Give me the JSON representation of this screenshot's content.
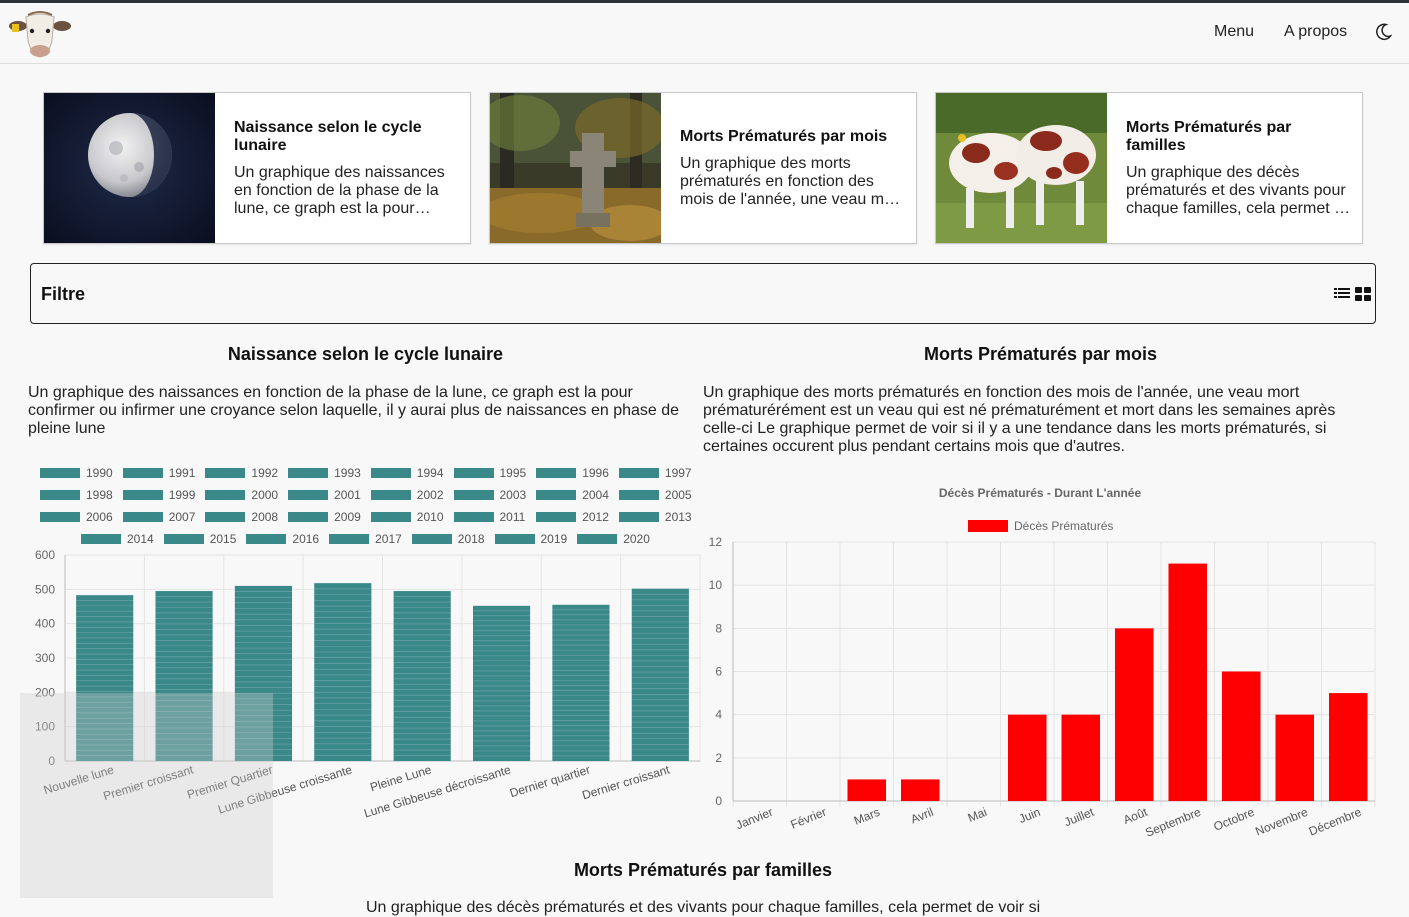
{
  "nav": {
    "menu_label": "Menu",
    "about_label": "A propos",
    "logo_icon": "cow-head-icon",
    "theme_icon": "moon-icon"
  },
  "cards": [
    {
      "title": "Naissance selon le cycle lunaire",
      "text": "Un graphique des naissances en fonction de la phase de la lune, ce graph est la pour confirmer ou infirmer une croyance selon laquelle, il y aurai plus de naissances en phase de pleine lune",
      "image_icon": "moon-photo"
    },
    {
      "title": "Morts Prématurés par mois",
      "text": "Un graphique des morts prématurés en fonction des mois de l'année, une veau mort prématurérément est un veau qui est né prématurément et mort dans les semaines après celle-ci",
      "image_icon": "cemetery-photo"
    },
    {
      "title": "Morts Prématurés par familles",
      "text": "Un graphique des décès prématurés et des vivants pour chaque familles, cela permet de voir si",
      "image_icon": "calves-photo"
    }
  ],
  "filter": {
    "title": "Filtre",
    "list_view_icon": "list-view-icon",
    "grid_view_icon": "grid-view-icon"
  },
  "sections": {
    "lunar": {
      "title": "Naissance selon le cycle lunaire",
      "description": "Un graphique des naissances en fonction de la phase de la lune, ce graph est la pour confirmer ou infirmer une croyance selon laquelle, il y aurai plus de naissances en phase de pleine lune"
    },
    "monthly": {
      "title": "Morts Prématurés par mois",
      "description": "Un graphique des morts prématurés en fonction des mois de l'année, une veau mort prématurérément est un veau qui est né prématurément et mort dans les semaines après celle-ci Le graphique permet de voir si il y a une tendance dans les morts prématurés, si certaines occurent plus pendant certains mois que d'autres."
    },
    "families": {
      "title": "Morts Prématurés par familles",
      "description": "Un graphique des décès prématurés et des vivants pour chaque familles, cela permet de voir si"
    }
  },
  "chart_data": [
    {
      "type": "bar",
      "title": "",
      "legend_position": "top",
      "legend": [
        "1990",
        "1991",
        "1992",
        "1993",
        "1994",
        "1995",
        "1996",
        "1997",
        "1998",
        "1999",
        "2000",
        "2001",
        "2002",
        "2003",
        "2004",
        "2005",
        "2006",
        "2007",
        "2008",
        "2009",
        "2010",
        "2011",
        "2012",
        "2013",
        "2014",
        "2015",
        "2016",
        "2017",
        "2018",
        "2019",
        "2020"
      ],
      "categories": [
        "Nouvelle lune",
        "Premier croissant",
        "Premier Quartier",
        "Lune Gibbeuse croissante",
        "Pleine Lune",
        "Lune Gibbeuse décroissante",
        "Dernier quartier",
        "Dernier croissant"
      ],
      "values": [
        483,
        495,
        510,
        518,
        495,
        452,
        455,
        502
      ],
      "ylim": [
        0,
        600
      ],
      "yticks": [
        0,
        100,
        200,
        300,
        400,
        500,
        600
      ],
      "stacked": true,
      "color": "#3a8888",
      "grid": true
    },
    {
      "type": "bar",
      "title": "Décès Prématurés - Durant L'année",
      "legend_position": "top",
      "series": [
        {
          "name": "Décès Prématurés",
          "values": [
            0,
            0,
            1,
            1,
            0,
            4,
            4,
            8,
            11,
            6,
            4,
            5
          ]
        }
      ],
      "categories": [
        "Janvier",
        "Février",
        "Mars",
        "Avril",
        "Mai",
        "Juin",
        "Juillet",
        "Août",
        "Septembre",
        "Octobre",
        "Novembre",
        "Décembre"
      ],
      "ylim": [
        0,
        12
      ],
      "yticks": [
        0,
        2,
        4,
        6,
        8,
        10,
        12
      ],
      "color": "#ff0000",
      "grid": true
    }
  ]
}
